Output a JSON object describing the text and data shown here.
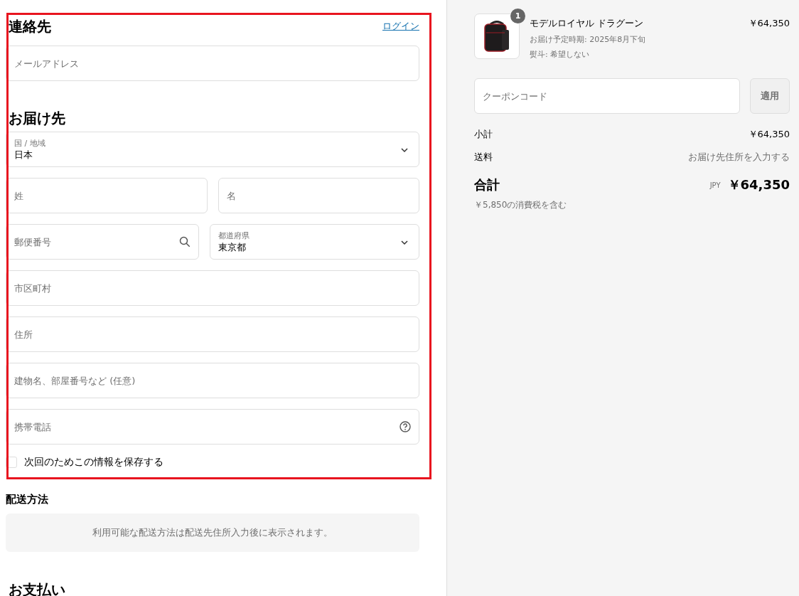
{
  "highlight_frame": {
    "shown": true
  },
  "contact": {
    "title": "連絡先",
    "login_link": "ログイン",
    "email": {
      "placeholder": "メールアドレス"
    }
  },
  "delivery": {
    "title": "お届け先",
    "rows": [
      [
        {
          "kind": "select",
          "label": "国 / 地域",
          "value": "日本"
        }
      ],
      [
        {
          "kind": "text",
          "placeholder": "姓"
        },
        {
          "kind": "text",
          "placeholder": "名"
        }
      ],
      [
        {
          "kind": "search",
          "placeholder": "郵便番号"
        },
        {
          "kind": "select",
          "label": "都道府県",
          "value": "東京都"
        }
      ],
      [
        {
          "kind": "text",
          "placeholder": "市区町村"
        }
      ],
      [
        {
          "kind": "text",
          "placeholder": "住所"
        }
      ],
      [
        {
          "kind": "text",
          "placeholder": "建物名、部屋番号など (任意)"
        }
      ],
      [
        {
          "kind": "help",
          "placeholder": "携帯電話"
        }
      ]
    ],
    "save_info": {
      "label": "次回のためこの情報を保存する",
      "checked": false
    }
  },
  "shipping": {
    "title": "配送方法",
    "notice": "利用可能な配送方法は配送先住所入力後に表示されます。"
  },
  "payment": {
    "title": "お支払い"
  },
  "summary": {
    "item": {
      "quantity": "1",
      "name": "モデルロイヤル ドラグーン",
      "delivery_date": "お届け予定時期: 2025年8月下旬",
      "noshi": "熨斗: 希望しない",
      "price": "￥64,350"
    },
    "coupon": {
      "placeholder": "クーポンコード",
      "button": "適用"
    },
    "lines": [
      {
        "label": "小計",
        "value": "￥64,350",
        "kind": "amount"
      },
      {
        "label": "送料",
        "value": "お届け先住所を入力する",
        "kind": "note"
      }
    ],
    "total": {
      "label": "合計",
      "currency": "JPY",
      "amount": "￥64,350",
      "tax_note": "￥5,850の消費税を含む"
    }
  }
}
